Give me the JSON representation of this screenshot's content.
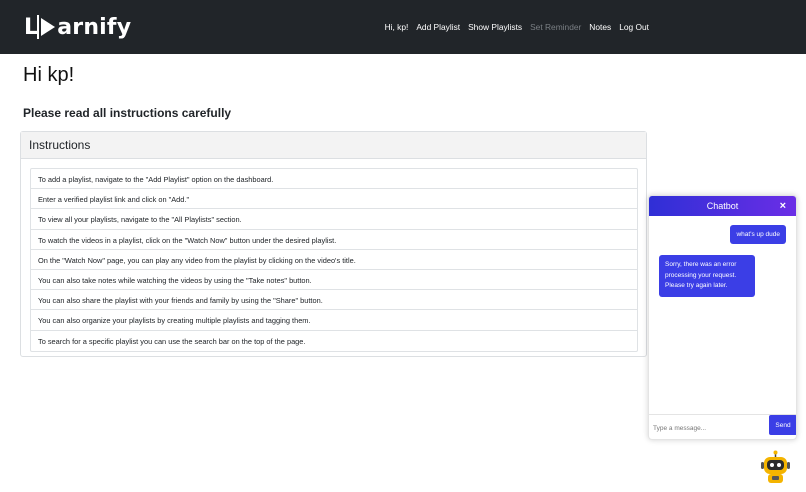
{
  "navbar": {
    "brand_pre": "L",
    "brand_post": "arnify",
    "links": [
      {
        "label": "Hi, kp!"
      },
      {
        "label": "Add Playlist"
      },
      {
        "label": "Show Playlists"
      },
      {
        "label": "Set Reminder"
      },
      {
        "label": "Notes"
      },
      {
        "label": "Log Out"
      }
    ]
  },
  "main": {
    "greeting": "Hi kp!",
    "subheading": "Please read all instructions carefully",
    "card_title": "Instructions",
    "instructions": [
      "To add a playlist, navigate to the \"Add Playlist\" option on the dashboard.",
      "Enter a verified playlist link and click on \"Add.\"",
      "To view all your playlists, navigate to the \"All Playlists\" section.",
      "To watch the videos in a playlist, click on the \"Watch Now\" button under the desired playlist.",
      "On the \"Watch Now\" page, you can play any video from the playlist by clicking on the video's title.",
      "You can also take notes while watching the videos by using the \"Take notes\" button.",
      "You can also share the playlist with your friends and family by using the \"Share\" button.",
      "You can also organize your playlists by creating multiple playlists and tagging them.",
      "To search for a specific playlist you can use the search bar on the top of the page."
    ]
  },
  "chatbot": {
    "title": "Chatbot",
    "close": "×",
    "user_message": "what's up dude",
    "bot_message": "Sorry, there was an error processing your request. Please try again later.",
    "input_placeholder": "Type a message...",
    "send_label": "Send"
  },
  "colors": {
    "navbar_bg": "#212529",
    "accent": "#3b3ee6",
    "muted_link": "#7a7f84"
  },
  "icons": {
    "brand_play": "play-icon",
    "chat_launcher": "robot-icon"
  }
}
